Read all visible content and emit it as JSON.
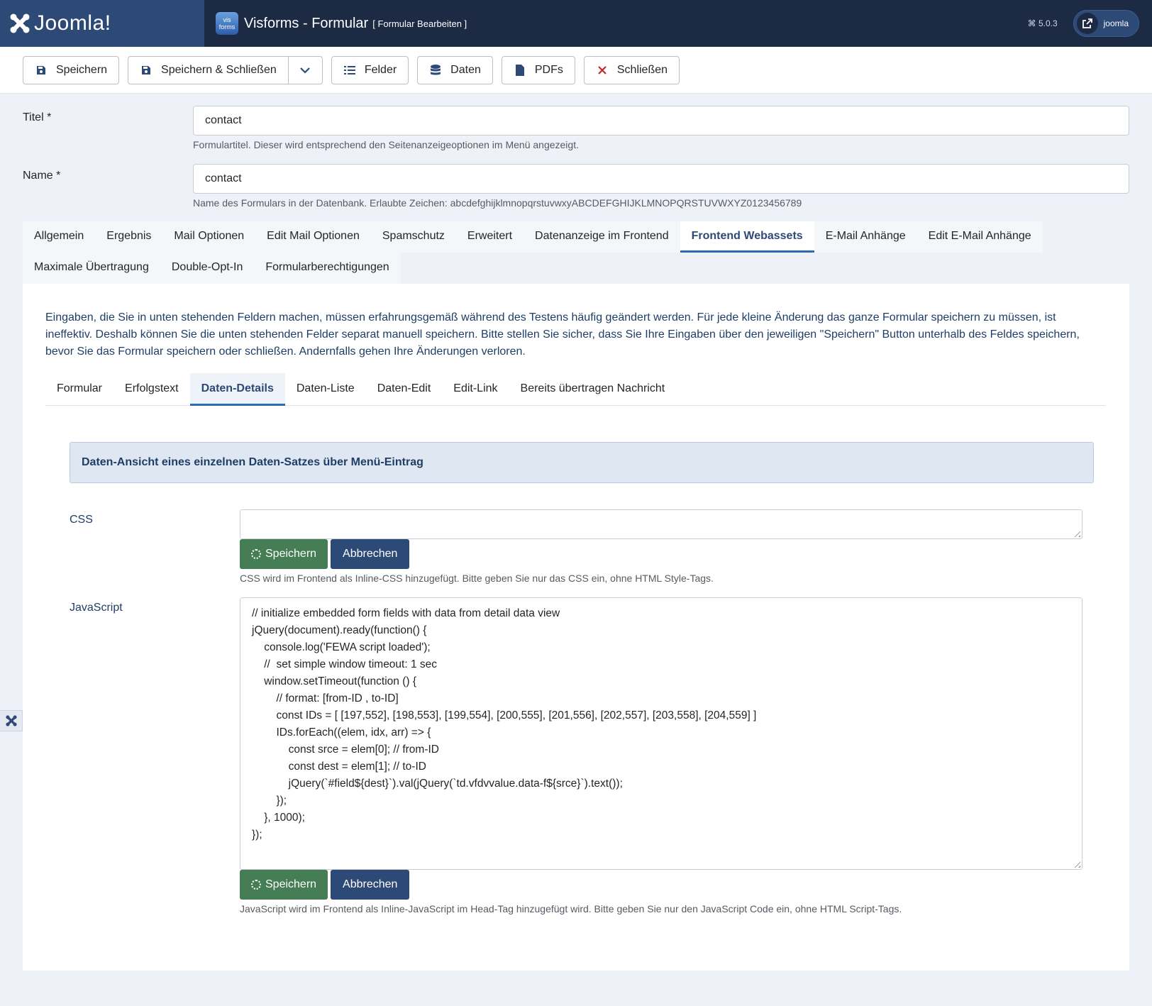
{
  "header": {
    "logo_text": "Joomla!",
    "app_icon_text_top": "vis",
    "app_icon_text_bottom": "forms",
    "title": "Visforms - Formular",
    "subtitle": "[ Formular Bearbeiten ]",
    "version": "5.0.3",
    "user": "joomla"
  },
  "toolbar": {
    "save": "Speichern",
    "save_close": "Speichern & Schließen",
    "fields": "Felder",
    "data": "Daten",
    "pdfs": "PDFs",
    "close": "Schließen"
  },
  "form": {
    "title_label": "Titel *",
    "title_value": "contact",
    "title_hint": "Formulartitel. Dieser wird entsprechend den Seitenanzeigeoptionen im Menü angezeigt.",
    "name_label": "Name *",
    "name_value": "contact",
    "name_hint": "Name des Formulars in der Datenbank. Erlaubte Zeichen: abcdefghijklmnopqrstuvwxyABCDEFGHIJKLMNOPQRSTUVWXYZ0123456789"
  },
  "tabs": {
    "row1": [
      "Allgemein",
      "Ergebnis",
      "Mail Optionen",
      "Edit Mail Optionen",
      "Spamschutz",
      "Erweitert",
      "Datenanzeige im Frontend",
      "Frontend Webassets",
      "E-Mail Anhänge",
      "Edit E-Mail Anhänge"
    ],
    "row2": [
      "Maximale Übertragung",
      "Double-Opt-In",
      "Formularberechtigungen"
    ],
    "active": "Frontend Webassets"
  },
  "panel": {
    "intro": "Eingaben, die Sie in unten stehenden Feldern machen, müssen erfahrungsgemäß während des Testens häufig geändert werden. Für jede kleine Änderung das ganze Formular speichern zu müssen, ist ineffektiv. Deshalb können Sie die unten stehenden Felder separat manuell speichern. Bitte stellen Sie sicher, dass Sie Ihre Eingaben über den jeweiligen \"Speichern\" Button unterhalb des Feldes speichern, bevor Sie das Formular speichern oder schließen. Andernfalls gehen Ihre Änderungen verloren.",
    "subtabs": [
      "Formular",
      "Erfolgstext",
      "Daten-Details",
      "Daten-Liste",
      "Daten-Edit",
      "Edit-Link",
      "Bereits übertragen Nachricht"
    ],
    "active_subtab": "Daten-Details",
    "info": "Daten-Ansicht eines einzelnen Daten-Satzes über Menü-Eintrag",
    "css_label": "CSS",
    "css_value": "",
    "save_label": "Speichern",
    "cancel_label": "Abbrechen",
    "css_hint": "CSS wird im Frontend als Inline-CSS hinzugefügt. Bitte geben Sie nur das CSS ein, ohne HTML Style-Tags.",
    "js_label": "JavaScript",
    "js_value": "// initialize embedded form fields with data from detail data view\njQuery(document).ready(function() {\n    console.log('FEWA script loaded');\n    //  set simple window timeout: 1 sec\n    window.setTimeout(function () {\n        // format: [from-ID , to-ID]\n        const IDs = [ [197,552], [198,553], [199,554], [200,555], [201,556], [202,557], [203,558], [204,559] ]\n        IDs.forEach((elem, idx, arr) => {\n            const srce = elem[0]; // from-ID\n            const dest = elem[1]; // to-ID\n            jQuery(`#field${dest}`).val(jQuery(`td.vfdvvalue.data-f${srce}`).text());\n        });\n    }, 1000);\n});",
    "js_hint": "JavaScript wird im Frontend als Inline-JavaScript im Head-Tag hinzugefügt wird. Bitte geben Sie nur den JavaScript Code ein, ohne HTML Script-Tags."
  },
  "colors": {
    "header_bg": "#1c2a44",
    "logo_bg": "#2d4a77",
    "accent": "#2d6bb3",
    "save_green": "#457d54",
    "cancel_blue": "#2d4a77",
    "close_red": "#c52827"
  },
  "icons": {
    "logo": "joomla-logo-icon",
    "save": "floppy-disk-icon",
    "fields": "list-icon",
    "data": "database-icon",
    "pdfs": "file-icon",
    "close": "x-icon",
    "user": "external-link-icon",
    "spinner": "spinner-icon",
    "sidebar": "joomla-logo-icon"
  }
}
